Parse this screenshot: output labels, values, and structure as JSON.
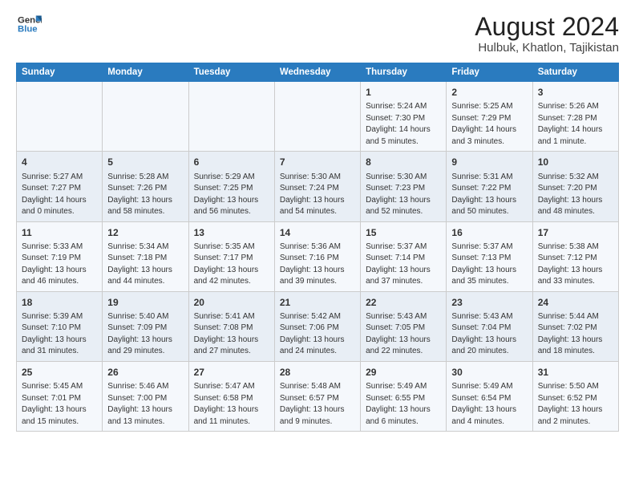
{
  "logo": {
    "line1": "General",
    "line2": "Blue"
  },
  "title": "August 2024",
  "subtitle": "Hulbuk, Khatlon, Tajikistan",
  "headers": [
    "Sunday",
    "Monday",
    "Tuesday",
    "Wednesday",
    "Thursday",
    "Friday",
    "Saturday"
  ],
  "weeks": [
    [
      {
        "day": "",
        "info": ""
      },
      {
        "day": "",
        "info": ""
      },
      {
        "day": "",
        "info": ""
      },
      {
        "day": "",
        "info": ""
      },
      {
        "day": "1",
        "info": "Sunrise: 5:24 AM\nSunset: 7:30 PM\nDaylight: 14 hours\nand 5 minutes."
      },
      {
        "day": "2",
        "info": "Sunrise: 5:25 AM\nSunset: 7:29 PM\nDaylight: 14 hours\nand 3 minutes."
      },
      {
        "day": "3",
        "info": "Sunrise: 5:26 AM\nSunset: 7:28 PM\nDaylight: 14 hours\nand 1 minute."
      }
    ],
    [
      {
        "day": "4",
        "info": "Sunrise: 5:27 AM\nSunset: 7:27 PM\nDaylight: 14 hours\nand 0 minutes."
      },
      {
        "day": "5",
        "info": "Sunrise: 5:28 AM\nSunset: 7:26 PM\nDaylight: 13 hours\nand 58 minutes."
      },
      {
        "day": "6",
        "info": "Sunrise: 5:29 AM\nSunset: 7:25 PM\nDaylight: 13 hours\nand 56 minutes."
      },
      {
        "day": "7",
        "info": "Sunrise: 5:30 AM\nSunset: 7:24 PM\nDaylight: 13 hours\nand 54 minutes."
      },
      {
        "day": "8",
        "info": "Sunrise: 5:30 AM\nSunset: 7:23 PM\nDaylight: 13 hours\nand 52 minutes."
      },
      {
        "day": "9",
        "info": "Sunrise: 5:31 AM\nSunset: 7:22 PM\nDaylight: 13 hours\nand 50 minutes."
      },
      {
        "day": "10",
        "info": "Sunrise: 5:32 AM\nSunset: 7:20 PM\nDaylight: 13 hours\nand 48 minutes."
      }
    ],
    [
      {
        "day": "11",
        "info": "Sunrise: 5:33 AM\nSunset: 7:19 PM\nDaylight: 13 hours\nand 46 minutes."
      },
      {
        "day": "12",
        "info": "Sunrise: 5:34 AM\nSunset: 7:18 PM\nDaylight: 13 hours\nand 44 minutes."
      },
      {
        "day": "13",
        "info": "Sunrise: 5:35 AM\nSunset: 7:17 PM\nDaylight: 13 hours\nand 42 minutes."
      },
      {
        "day": "14",
        "info": "Sunrise: 5:36 AM\nSunset: 7:16 PM\nDaylight: 13 hours\nand 39 minutes."
      },
      {
        "day": "15",
        "info": "Sunrise: 5:37 AM\nSunset: 7:14 PM\nDaylight: 13 hours\nand 37 minutes."
      },
      {
        "day": "16",
        "info": "Sunrise: 5:37 AM\nSunset: 7:13 PM\nDaylight: 13 hours\nand 35 minutes."
      },
      {
        "day": "17",
        "info": "Sunrise: 5:38 AM\nSunset: 7:12 PM\nDaylight: 13 hours\nand 33 minutes."
      }
    ],
    [
      {
        "day": "18",
        "info": "Sunrise: 5:39 AM\nSunset: 7:10 PM\nDaylight: 13 hours\nand 31 minutes."
      },
      {
        "day": "19",
        "info": "Sunrise: 5:40 AM\nSunset: 7:09 PM\nDaylight: 13 hours\nand 29 minutes."
      },
      {
        "day": "20",
        "info": "Sunrise: 5:41 AM\nSunset: 7:08 PM\nDaylight: 13 hours\nand 27 minutes."
      },
      {
        "day": "21",
        "info": "Sunrise: 5:42 AM\nSunset: 7:06 PM\nDaylight: 13 hours\nand 24 minutes."
      },
      {
        "day": "22",
        "info": "Sunrise: 5:43 AM\nSunset: 7:05 PM\nDaylight: 13 hours\nand 22 minutes."
      },
      {
        "day": "23",
        "info": "Sunrise: 5:43 AM\nSunset: 7:04 PM\nDaylight: 13 hours\nand 20 minutes."
      },
      {
        "day": "24",
        "info": "Sunrise: 5:44 AM\nSunset: 7:02 PM\nDaylight: 13 hours\nand 18 minutes."
      }
    ],
    [
      {
        "day": "25",
        "info": "Sunrise: 5:45 AM\nSunset: 7:01 PM\nDaylight: 13 hours\nand 15 minutes."
      },
      {
        "day": "26",
        "info": "Sunrise: 5:46 AM\nSunset: 7:00 PM\nDaylight: 13 hours\nand 13 minutes."
      },
      {
        "day": "27",
        "info": "Sunrise: 5:47 AM\nSunset: 6:58 PM\nDaylight: 13 hours\nand 11 minutes."
      },
      {
        "day": "28",
        "info": "Sunrise: 5:48 AM\nSunset: 6:57 PM\nDaylight: 13 hours\nand 9 minutes."
      },
      {
        "day": "29",
        "info": "Sunrise: 5:49 AM\nSunset: 6:55 PM\nDaylight: 13 hours\nand 6 minutes."
      },
      {
        "day": "30",
        "info": "Sunrise: 5:49 AM\nSunset: 6:54 PM\nDaylight: 13 hours\nand 4 minutes."
      },
      {
        "day": "31",
        "info": "Sunrise: 5:50 AM\nSunset: 6:52 PM\nDaylight: 13 hours\nand 2 minutes."
      }
    ]
  ]
}
